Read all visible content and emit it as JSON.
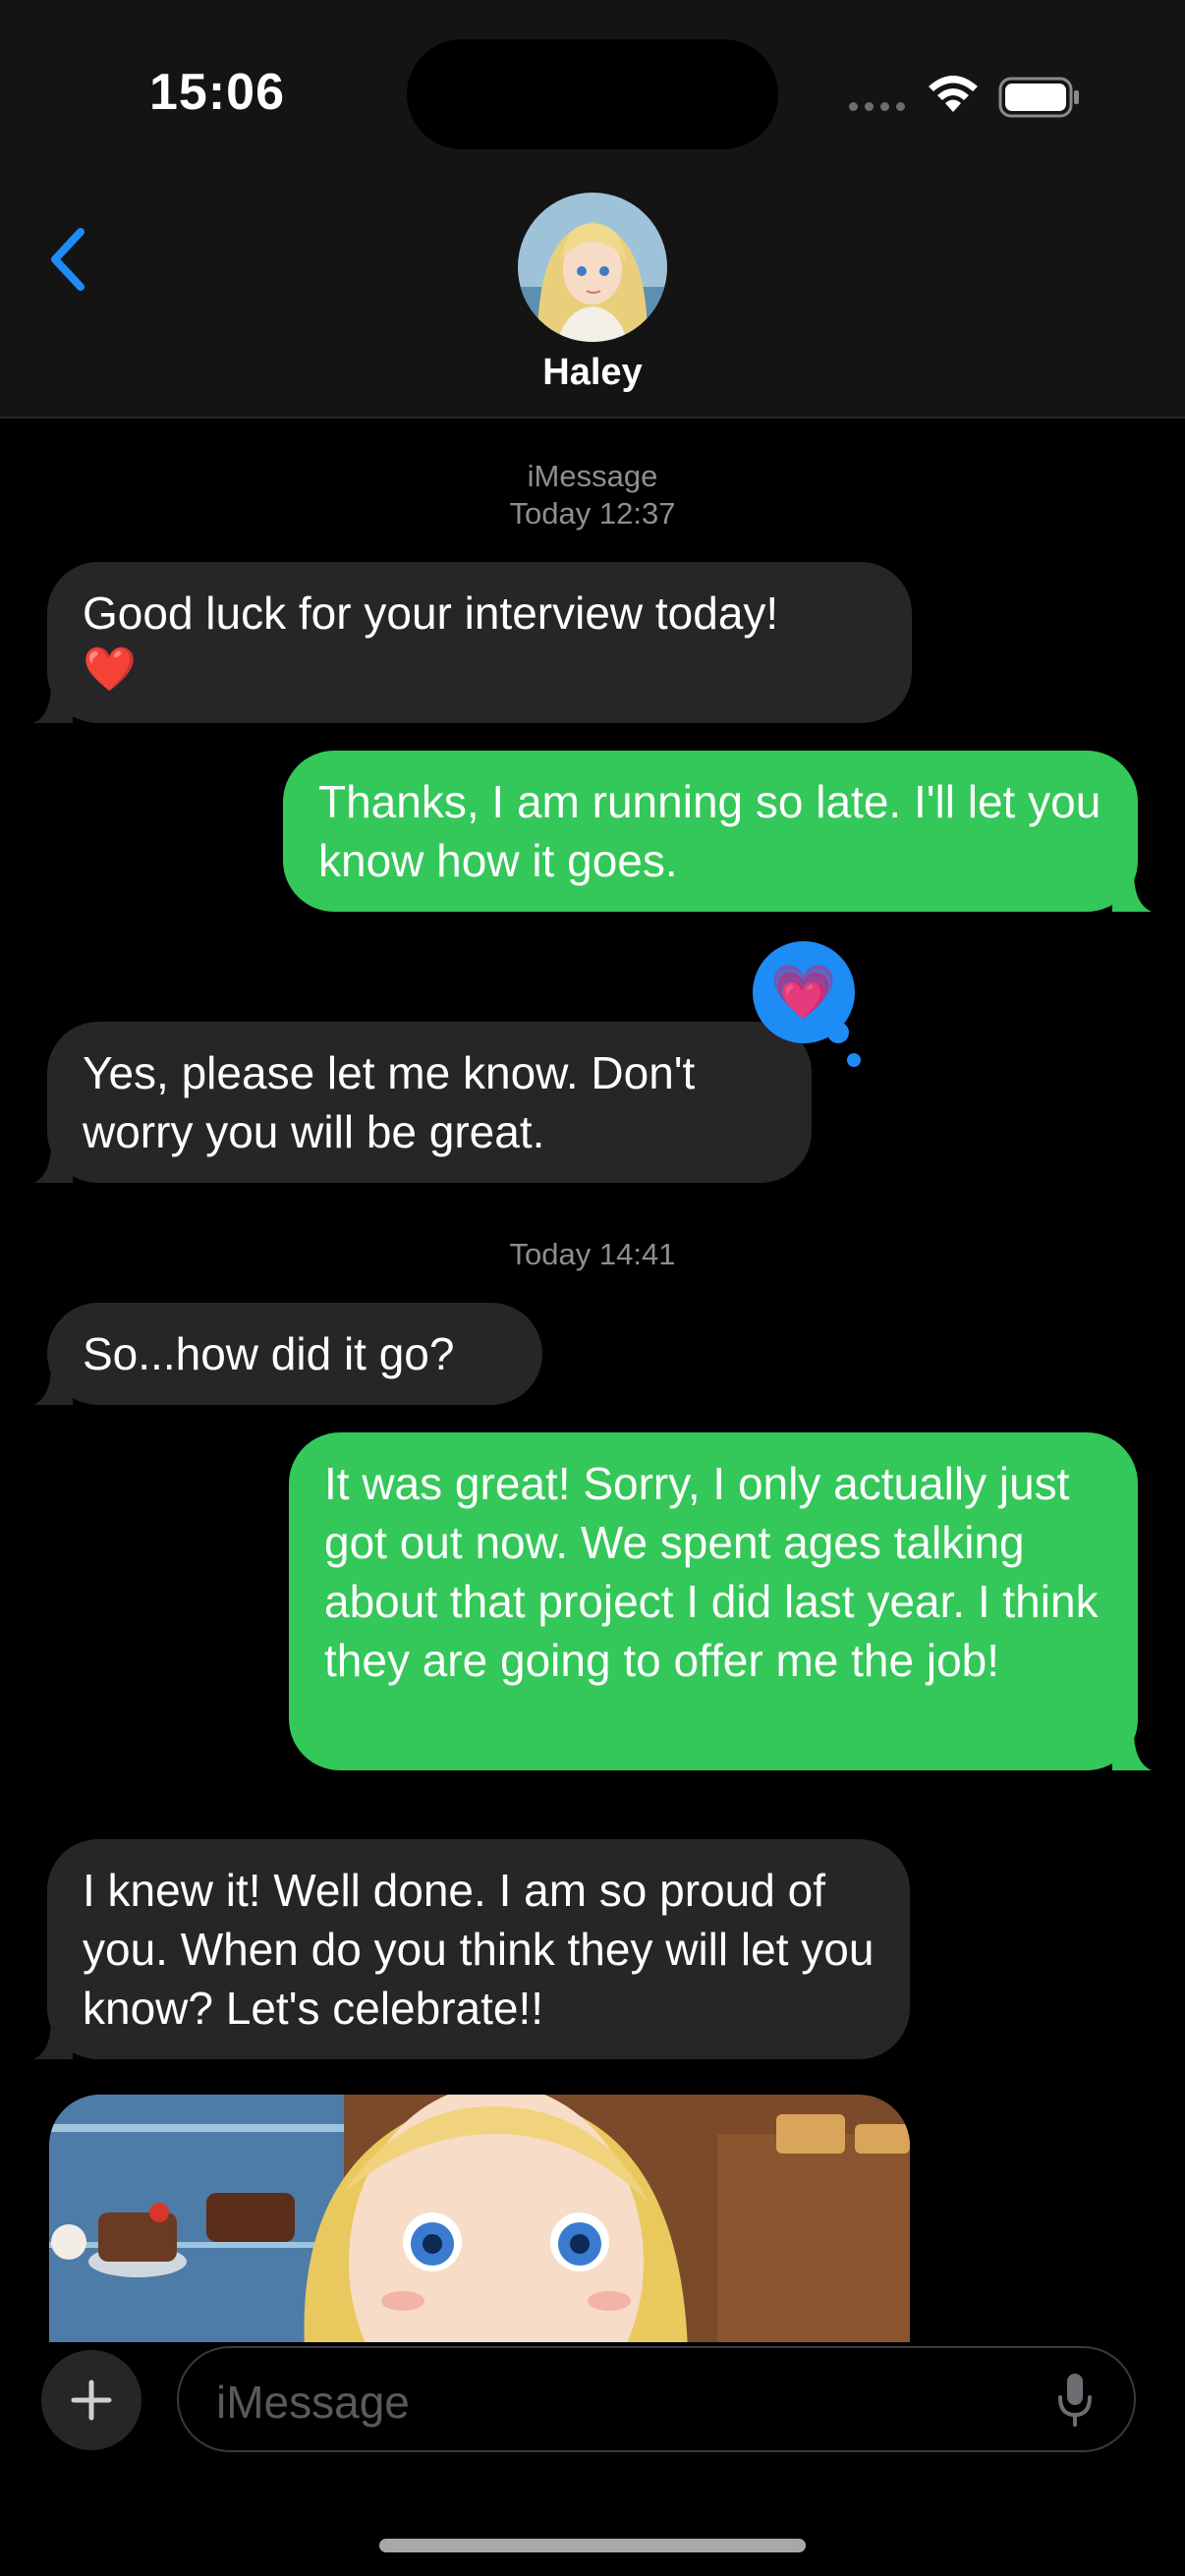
{
  "status_bar": {
    "time": "15:06"
  },
  "header": {
    "contact_name": "Haley",
    "back_icon": "chevron-left-icon"
  },
  "conversation": {
    "service_label": "iMessage",
    "first_timestamp": "Today 12:37",
    "second_timestamp": "Today 14:41",
    "messages": [
      {
        "from": "Haley",
        "text": "Good luck for your interview today!",
        "emoji": "❤️"
      },
      {
        "from": "me",
        "text": "Thanks, I am running so late. I'll let you know how it goes."
      },
      {
        "from": "Haley",
        "text": "Yes, please let me know. Don't worry you will be great.",
        "reaction": "💗"
      },
      {
        "from": "Haley",
        "text": "So...how did it go?"
      },
      {
        "from": "me",
        "text": "It was great! Sorry, I only actually just got out now. We spent ages talking about that project I did last year. I think they are going to offer me the job!"
      },
      {
        "from": "Haley",
        "text": "I knew it! Well done. I am so proud of you. When do you think they will let you know? Let's celebrate!!"
      }
    ]
  },
  "composer": {
    "placeholder": "iMessage"
  },
  "colors": {
    "outgoing": "#34c759",
    "incoming": "#262628",
    "accent": "#1e8cf5"
  }
}
